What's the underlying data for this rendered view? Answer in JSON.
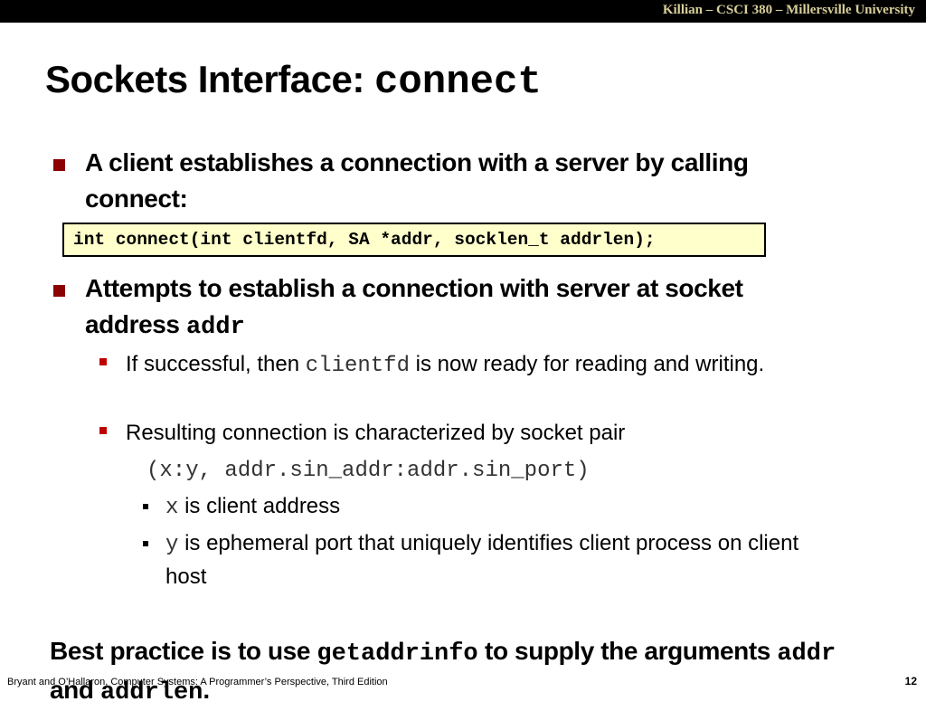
{
  "header": {
    "course_info": "Killian – CSCI 380 – Millersville University"
  },
  "slide": {
    "title_text": "Sockets Interface: ",
    "title_code": "connect",
    "bullet1": {
      "text": "A client establishes a connection with a server by calling connect:"
    },
    "code_signature": "int connect(int clientfd, SA *addr, socklen_t addrlen);",
    "bullet2": {
      "text": "Attempts to establish a connection with server at socket address ",
      "code": "addr"
    },
    "sub1": {
      "pre": "If successful, then ",
      "code": "clientfd",
      "post": " is now ready for reading and writing."
    },
    "sub2": {
      "text": "Resulting connection is  characterized by socket pair"
    },
    "socket_pair": "(x:y, addr.sin_addr:addr.sin_port)",
    "subsub1": {
      "code": "x",
      "text": " is client address"
    },
    "subsub2": {
      "code": "y",
      "text": " is ephemeral port that uniquely identifies client process on client host"
    },
    "best_practice": {
      "pre": "Best practice is to use ",
      "code1": "getaddrinfo",
      "mid": " to supply the arguments ",
      "code2": "addr",
      "and": " and ",
      "code3": "addrlen",
      "post": "."
    }
  },
  "footer": {
    "citation": "Bryant and O’Hallaron, Computer Systems: A Programmer’s Perspective, Third Edition",
    "page_number": "12"
  },
  "colors": {
    "header_bar": "#000000",
    "header_text": "#d8cf9a",
    "bullet_level1": "#8b0000",
    "bullet_level2": "#c00000",
    "code_box_bg": "#ffffcc"
  }
}
